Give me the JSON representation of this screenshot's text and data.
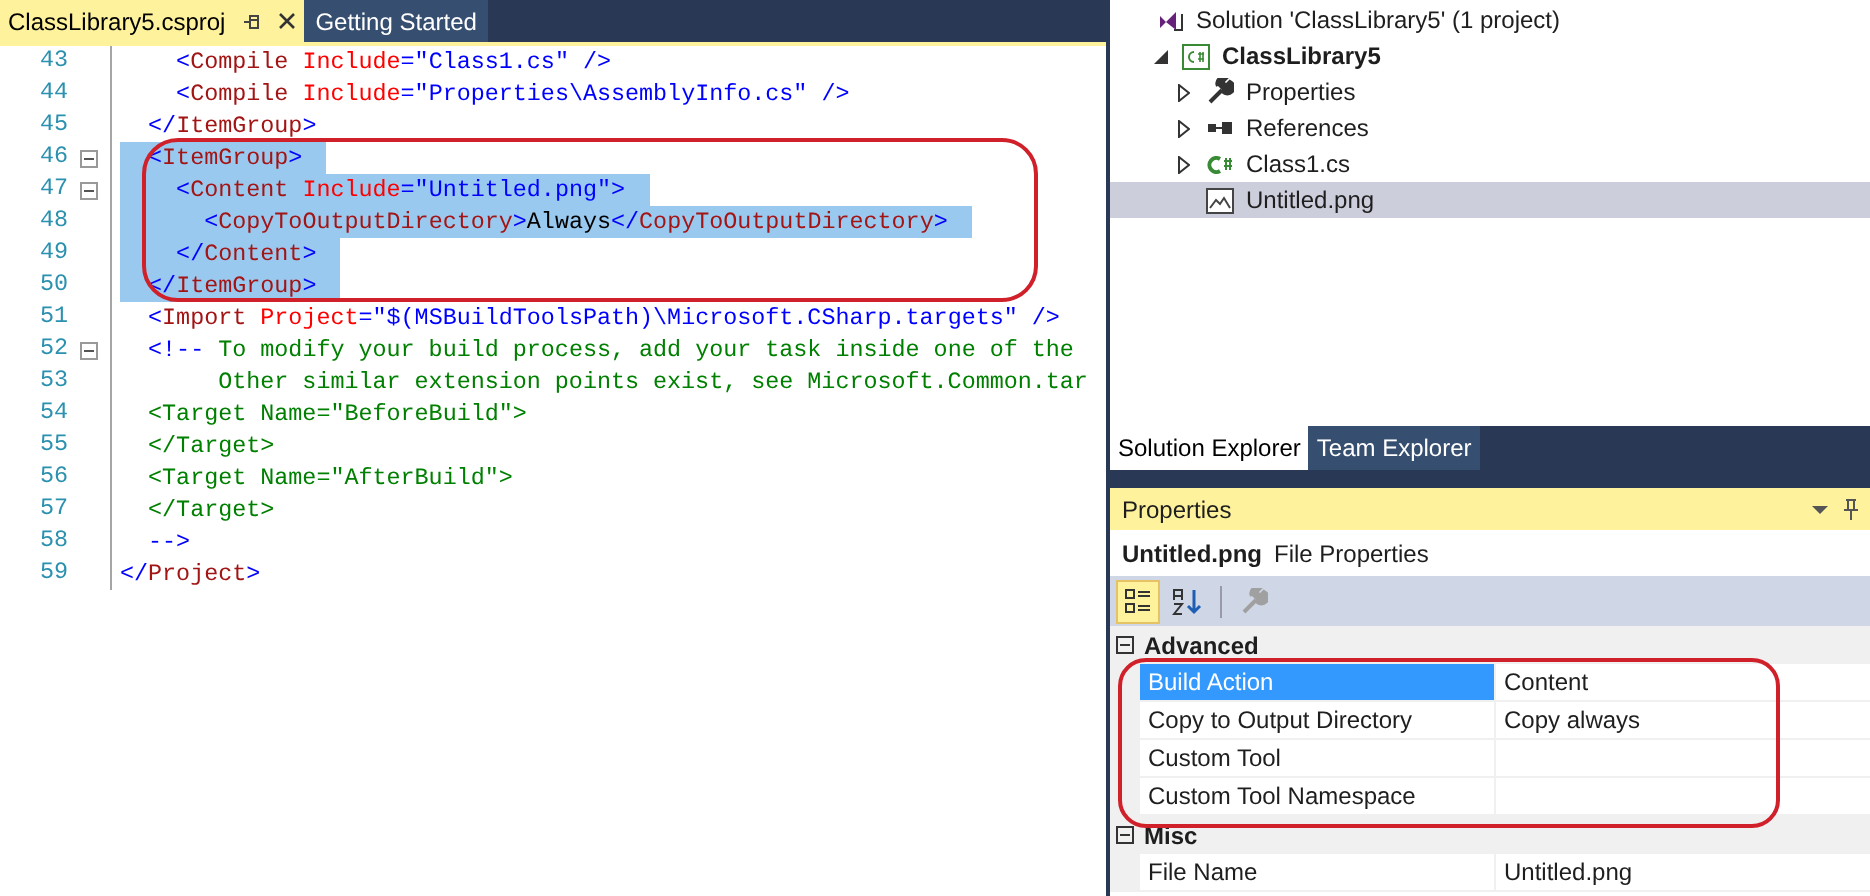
{
  "editor": {
    "tabs": [
      {
        "label": "ClassLibrary5.csproj",
        "selected": true
      },
      {
        "label": "Getting Started",
        "selected": false
      }
    ],
    "lines": [
      {
        "number": "43",
        "fold": false,
        "selected": false,
        "tokens": [
          {
            "kind": "delimiter",
            "text": "    <"
          },
          {
            "kind": "element",
            "text": "Compile"
          },
          {
            "kind": "attribute",
            "text": " Include"
          },
          {
            "kind": "delimiter",
            "text": "=\"Class1.cs\" />"
          }
        ]
      },
      {
        "number": "44",
        "fold": false,
        "selected": false,
        "tokens": [
          {
            "kind": "delimiter",
            "text": "    <"
          },
          {
            "kind": "element",
            "text": "Compile"
          },
          {
            "kind": "attribute",
            "text": " Include"
          },
          {
            "kind": "delimiter",
            "text": "=\"Properties\\AssemblyInfo.cs\" />"
          }
        ]
      },
      {
        "number": "45",
        "fold": false,
        "selected": false,
        "tokens": [
          {
            "kind": "delimiter",
            "text": "  </"
          },
          {
            "kind": "element",
            "text": "ItemGroup"
          },
          {
            "kind": "delimiter",
            "text": ">"
          }
        ]
      },
      {
        "number": "46",
        "fold": true,
        "selected": true,
        "tokens": [
          {
            "kind": "delimiter",
            "text": "  <"
          },
          {
            "kind": "element",
            "text": "ItemGroup"
          },
          {
            "kind": "delimiter",
            "text": ">"
          }
        ]
      },
      {
        "number": "47",
        "fold": true,
        "selected": true,
        "tokens": [
          {
            "kind": "delimiter",
            "text": "    <"
          },
          {
            "kind": "element",
            "text": "Content"
          },
          {
            "kind": "attribute",
            "text": " Include"
          },
          {
            "kind": "delimiter",
            "text": "=\"Untitled.png\">"
          }
        ]
      },
      {
        "number": "48",
        "fold": false,
        "selected": true,
        "tokens": [
          {
            "kind": "delimiter",
            "text": "      <"
          },
          {
            "kind": "element",
            "text": "CopyToOutputDirectory"
          },
          {
            "kind": "delimiter",
            "text": ">"
          },
          {
            "kind": "plain",
            "text": "Always"
          },
          {
            "kind": "delimiter",
            "text": "</"
          },
          {
            "kind": "element",
            "text": "CopyToOutputDirectory"
          },
          {
            "kind": "delimiter",
            "text": ">"
          }
        ]
      },
      {
        "number": "49",
        "fold": false,
        "selected": true,
        "tokens": [
          {
            "kind": "delimiter",
            "text": "    </"
          },
          {
            "kind": "element",
            "text": "Content"
          },
          {
            "kind": "delimiter",
            "text": ">"
          }
        ]
      },
      {
        "number": "50",
        "fold": false,
        "selected": true,
        "tokens": [
          {
            "kind": "delimiter",
            "text": "  </"
          },
          {
            "kind": "element",
            "text": "ItemGroup"
          },
          {
            "kind": "delimiter",
            "text": ">"
          }
        ]
      },
      {
        "number": "51",
        "fold": false,
        "selected": false,
        "tokens": [
          {
            "kind": "delimiter",
            "text": "  <"
          },
          {
            "kind": "element",
            "text": "Import"
          },
          {
            "kind": "attribute",
            "text": " Project"
          },
          {
            "kind": "delimiter",
            "text": "=\"$(MSBuildToolsPath)\\Microsoft.CSharp.targets\" />"
          }
        ]
      },
      {
        "number": "52",
        "fold": true,
        "selected": false,
        "tokens": [
          {
            "kind": "delimiter",
            "text": "  <!--"
          },
          {
            "kind": "comment",
            "text": " To modify your build process, add your task inside one of the"
          }
        ]
      },
      {
        "number": "53",
        "fold": false,
        "selected": false,
        "tokens": [
          {
            "kind": "comment",
            "text": "       Other similar extension points exist, see Microsoft.Common.tar"
          }
        ]
      },
      {
        "number": "54",
        "fold": false,
        "selected": false,
        "tokens": [
          {
            "kind": "comment",
            "text": "  <Target Name=\"BeforeBuild\">"
          }
        ]
      },
      {
        "number": "55",
        "fold": false,
        "selected": false,
        "tokens": [
          {
            "kind": "comment",
            "text": "  </Target>"
          }
        ]
      },
      {
        "number": "56",
        "fold": false,
        "selected": false,
        "tokens": [
          {
            "kind": "comment",
            "text": "  <Target Name=\"AfterBuild\">"
          }
        ]
      },
      {
        "number": "57",
        "fold": false,
        "selected": false,
        "tokens": [
          {
            "kind": "comment",
            "text": "  </Target>"
          }
        ]
      },
      {
        "number": "58",
        "fold": false,
        "selected": false,
        "tokens": [
          {
            "kind": "delimiter",
            "text": "  -->"
          }
        ]
      },
      {
        "number": "59",
        "fold": false,
        "selected": false,
        "tokens": [
          {
            "kind": "delimiter",
            "text": "</"
          },
          {
            "kind": "element",
            "text": "Project"
          },
          {
            "kind": "delimiter",
            "text": ">"
          }
        ]
      }
    ]
  },
  "solution_explorer": {
    "tree": [
      {
        "label": "Solution 'ClassLibrary5' (1 project)",
        "kind": "solution",
        "selected": false,
        "children": [
          {
            "label": "ClassLibrary5",
            "kind": "project",
            "expanded": true,
            "selected": false,
            "children": [
              {
                "label": "Properties",
                "kind": "properties",
                "expanded": false,
                "selected": false
              },
              {
                "label": "References",
                "kind": "references",
                "expanded": false,
                "selected": false
              },
              {
                "label": "Class1.cs",
                "kind": "csfile",
                "expanded": false,
                "selected": false
              },
              {
                "label": "Untitled.png",
                "kind": "image",
                "selected": true
              }
            ]
          }
        ]
      }
    ],
    "tabs": [
      {
        "label": "Solution Explorer",
        "selected": true
      },
      {
        "label": "Team Explorer",
        "selected": false
      }
    ]
  },
  "properties": {
    "title": "Properties",
    "object_name": "Untitled.png",
    "object_type": "File Properties",
    "toolbar": [
      {
        "kind": "categorized",
        "selected": true,
        "disabled": false
      },
      {
        "kind": "alphabetical",
        "selected": false,
        "disabled": false
      },
      {
        "kind": "wrench",
        "selected": false,
        "disabled": true
      }
    ],
    "categories": [
      {
        "name": "Advanced",
        "expanded": true,
        "rows": [
          {
            "name": "Build Action",
            "value": "Content",
            "selected": true
          },
          {
            "name": "Copy to Output Directory",
            "value": "Copy always",
            "selected": false
          },
          {
            "name": "Custom Tool",
            "selected": false
          },
          {
            "name": "Custom Tool Namespace",
            "selected": false
          }
        ]
      },
      {
        "name": "Misc",
        "expanded": true,
        "rows": [
          {
            "name": "File Name",
            "value": "Untitled.png",
            "selected": false
          }
        ]
      }
    ]
  }
}
